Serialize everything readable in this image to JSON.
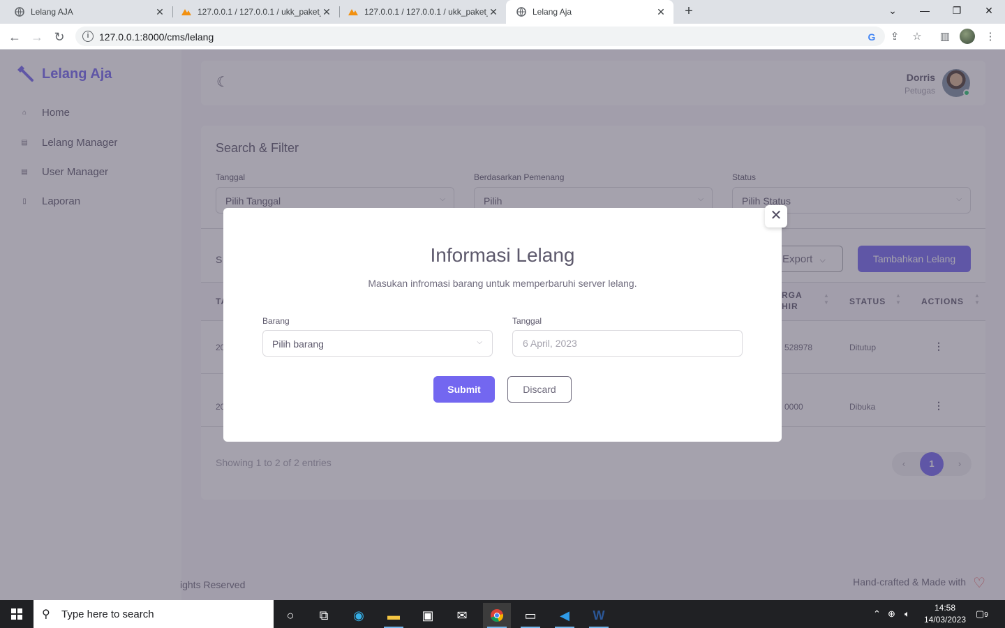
{
  "browser": {
    "tabs": [
      {
        "title": "Lelang AJA",
        "active": false
      },
      {
        "title": "127.0.0.1 / 127.0.0.1 / ukk_paket_",
        "active": false
      },
      {
        "title": "127.0.0.1 / 127.0.0.1 / ukk_paket_",
        "active": false
      },
      {
        "title": "Lelang Aja",
        "active": true
      }
    ],
    "url": "127.0.0.1:8000/cms/lelang"
  },
  "app": {
    "brand": "Lelang Aja",
    "menu": [
      {
        "label": "Home",
        "icon": "home-icon"
      },
      {
        "label": "Lelang Manager",
        "icon": "table-icon"
      },
      {
        "label": "User Manager",
        "icon": "table-icon"
      },
      {
        "label": "Laporan",
        "icon": "file-icon"
      }
    ],
    "user": {
      "name": "Dorris",
      "role": "Petugas"
    },
    "filter": {
      "title": "Search & Filter",
      "fields": [
        {
          "label": "Tanggal",
          "value": "Pilih Tanggal"
        },
        {
          "label": "Berdasarkan Pemenang",
          "value": "Pilih"
        },
        {
          "label": "Status",
          "value": "Pilih Status"
        }
      ]
    },
    "toolbar": {
      "show_prefix": "S",
      "export_label": "Export",
      "add_label": "Tambahkan Lelang"
    },
    "table": {
      "headers": {
        "first": "TA",
        "harga": "RGA\nHIR",
        "status": "STATUS",
        "actions": "ACTIONS"
      },
      "rows": [
        {
          "date_fragment": "20",
          "harga_fragment": "528978",
          "status": "Ditutup"
        },
        {
          "date_fragment": "20",
          "harga_fragment": "0000",
          "status": "Dibuka"
        }
      ]
    },
    "showing": "Showing 1 to 2 of 2 entries",
    "pagination": {
      "prev": "‹",
      "current": "1",
      "next": "›"
    },
    "footer": {
      "left": "ights Reserved",
      "right": "Hand-crafted & Made with"
    }
  },
  "modal": {
    "title": "Informasi Lelang",
    "subtitle": "Masukan infromasi barang untuk memperbaruhi server lelang.",
    "barang_label": "Barang",
    "barang_value": "Pilih barang",
    "tanggal_label": "Tanggal",
    "tanggal_placeholder": "6 April, 2023",
    "submit_label": "Submit",
    "discard_label": "Discard"
  },
  "taskbar": {
    "search_placeholder": "Type here to search",
    "time": "14:58",
    "date": "14/03/2023",
    "notification_count": "9"
  },
  "colors": {
    "primary": "#7367f0",
    "success": "#28c76f",
    "danger": "#ea5455"
  }
}
